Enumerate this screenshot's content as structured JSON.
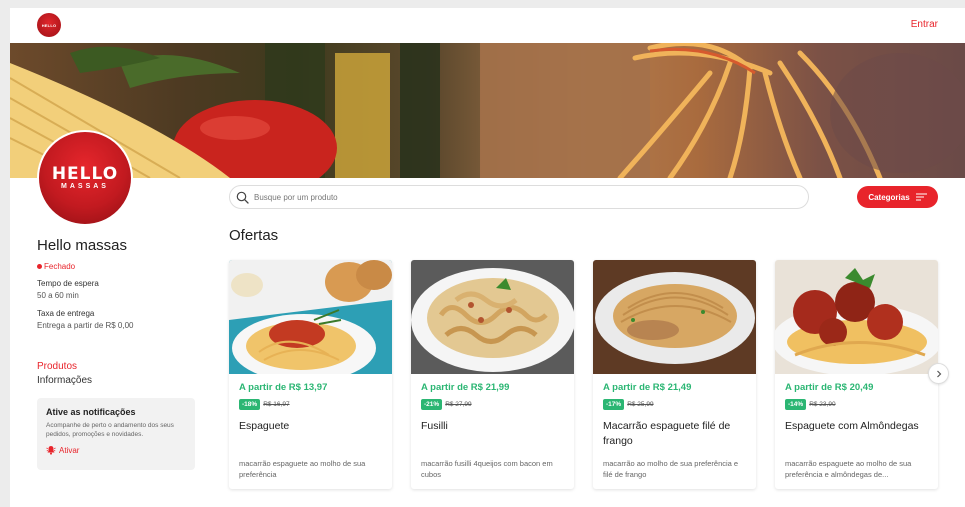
{
  "header": {
    "logo_text": "HELLO",
    "login_label": "Entrar"
  },
  "store": {
    "logo_line1": "HELLO",
    "logo_line2": "MASSAS",
    "name": "Hello massas",
    "status": "Fechado",
    "wait_label": "Tempo de espera",
    "wait_value": "50 a 60 min",
    "fee_label": "Taxa de entrega",
    "fee_value": "Entrega a partir de R$ 0,00"
  },
  "nav": {
    "products": "Produtos",
    "info": "Informações"
  },
  "notifications": {
    "title": "Ative as notificações",
    "description": "Acompanhe de perto o andamento dos seus pedidos, promoções e novidades.",
    "activate": "Ativar"
  },
  "search": {
    "placeholder": "Busque por um produto"
  },
  "categories_button": "Categorias",
  "section_title": "Ofertas",
  "products": [
    {
      "price": "A partir de R$ 13,97",
      "discount": "-18%",
      "old_price": "R$ 16,97",
      "name": "Espaguete",
      "description": "macarrão espaguete ao molho de sua preferência"
    },
    {
      "price": "A partir de R$ 21,99",
      "discount": "-21%",
      "old_price": "R$ 27,99",
      "name": "Fusilli",
      "description": "macarrão fusilli 4queijos com bacon em cubos"
    },
    {
      "price": "A partir de R$ 21,49",
      "discount": "-17%",
      "old_price": "R$ 25,99",
      "name": "Macarrão espaguete filé de frango",
      "description": "macarrão ao molho de sua preferência e filé de frango"
    },
    {
      "price": "A partir de R$ 20,49",
      "discount": "-14%",
      "old_price": "R$ 23,90",
      "name": "Espaguete com Almôndegas",
      "description": "macarrão espaguete ao molho de sua preferência e almôndegas de..."
    }
  ],
  "colors": {
    "brand_red": "#e8242b",
    "offer_green": "#2bb673"
  }
}
